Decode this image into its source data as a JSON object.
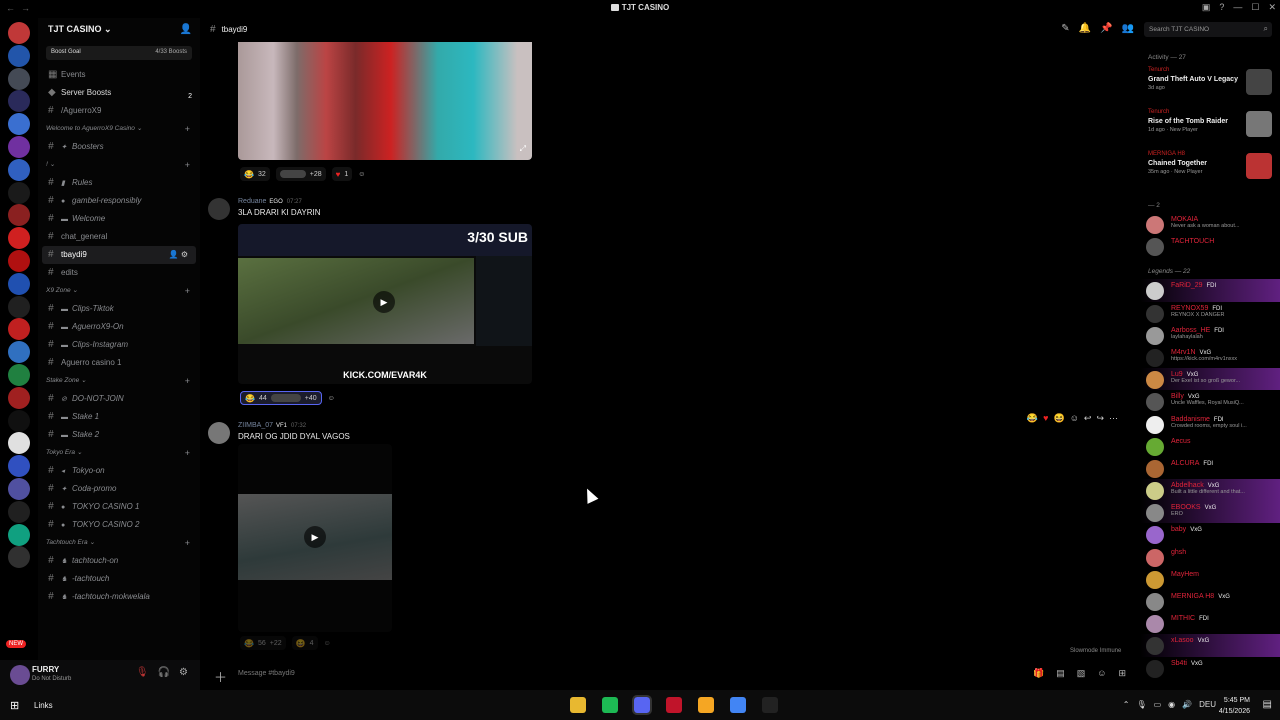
{
  "window": {
    "title": "TJT CASINO"
  },
  "server_rail": {
    "colors": [
      "#c03838",
      "#2255aa",
      "#444a55",
      "#2a2a5a",
      "#3a6fd0",
      "#7030a0",
      "#3060c0",
      "#1a1a1a",
      "#8a2020",
      "#d02020",
      "#b01010",
      "#2050b0",
      "#202020",
      "#c02020",
      "#3070c0",
      "#208040",
      "#a02020",
      "#101010",
      "#e0e0e0",
      "#3050c0",
      "#5050a0",
      "#202020",
      "#10a080",
      "#303030"
    ],
    "new_badge": "NEW"
  },
  "guild": {
    "name": "TJT CASINO",
    "boost_label": "Boost Goal",
    "boost_count": "4/33 Boosts"
  },
  "sidebar": {
    "events": "Events",
    "server_boosts": "Server Boosts",
    "server_boosts_badge": "2",
    "channels": [
      {
        "kind": "ch",
        "label": "/AguerroX9",
        "emoji": ""
      },
      {
        "kind": "cat",
        "label": "Welcome to AguerroX9 Casino"
      },
      {
        "kind": "ch",
        "label": "Boosters",
        "emoji": "✦",
        "italic": true
      },
      {
        "kind": "cat",
        "label": "!"
      },
      {
        "kind": "ch",
        "label": "Rules",
        "emoji": "▮",
        "italic": true
      },
      {
        "kind": "ch",
        "label": "gambel-responsibly",
        "emoji": "●",
        "italic": true
      },
      {
        "kind": "ch",
        "label": "Welcome",
        "emoji": "▬",
        "italic": true
      },
      {
        "kind": "ch",
        "label": "chat_general",
        "emoji": ""
      },
      {
        "kind": "ch",
        "label": "tbaydi9",
        "emoji": "",
        "active": true
      },
      {
        "kind": "ch",
        "label": "edits",
        "emoji": ""
      },
      {
        "kind": "cat",
        "label": "X9 Zone"
      },
      {
        "kind": "ch",
        "label": "Clips-Tiktok",
        "emoji": "▬",
        "italic": true
      },
      {
        "kind": "ch",
        "label": "AguerroX9-On",
        "emoji": "▬",
        "italic": true
      },
      {
        "kind": "ch",
        "label": "Clips-Instagram",
        "emoji": "▬",
        "italic": true
      },
      {
        "kind": "ch",
        "label": "Aguerro casino 1",
        "emoji": ""
      },
      {
        "kind": "cat",
        "label": "Stake Zone"
      },
      {
        "kind": "ch",
        "label": "DO-NOT-JOIN",
        "emoji": "⊘",
        "italic": true
      },
      {
        "kind": "ch",
        "label": "Stake 1",
        "emoji": "▬",
        "italic": true
      },
      {
        "kind": "ch",
        "label": "Stake 2",
        "emoji": "▬",
        "italic": true
      },
      {
        "kind": "cat",
        "label": "Tokyo Era"
      },
      {
        "kind": "ch",
        "label": "Tokyo-on",
        "emoji": "◂",
        "italic": true
      },
      {
        "kind": "ch",
        "label": "Coda-promo",
        "emoji": "✦",
        "italic": true
      },
      {
        "kind": "ch",
        "label": "TOKYO CASINO 1",
        "emoji": "●",
        "italic": true
      },
      {
        "kind": "ch",
        "label": "TOKYO CASINO 2",
        "emoji": "●",
        "italic": true
      },
      {
        "kind": "cat",
        "label": "Tachtouch Era"
      },
      {
        "kind": "ch",
        "label": "tachtouch-on",
        "emoji": "♞",
        "italic": true
      },
      {
        "kind": "ch",
        "label": "-tachtouch",
        "emoji": "♞",
        "italic": true
      },
      {
        "kind": "ch",
        "label": "-tachtouch-mokwelala",
        "emoji": "♞",
        "italic": true
      }
    ]
  },
  "user": {
    "name": "FURRY",
    "status": "Do Not Disturb"
  },
  "header": {
    "channel": "tbaydi9"
  },
  "search": {
    "placeholder": "Search TJT CASINO"
  },
  "messages": [
    {
      "reactions": [
        "32",
        "+28",
        "1"
      ]
    },
    {
      "author": "Reduane",
      "tag": "EGO",
      "time": "07:27",
      "text": "3LA DRARI KI DAYRIN",
      "overlay": "3/30 SUB",
      "kick": "KICK.COM/EVAR4K",
      "reactions": [
        "44",
        "+40"
      ]
    },
    {
      "author": "ZIIMBA_07",
      "tag": "VF1",
      "time": "07:32",
      "text": "DRARI OG JDID DYAL VAGOS",
      "reactions": [
        "56",
        "+22",
        "4"
      ]
    }
  ],
  "slowmode": "Slowmode Immune",
  "composer": {
    "placeholder": "Message #tbaydi9"
  },
  "members": {
    "activity_header": "Activity — 27",
    "activities": [
      {
        "user": "Tenurch",
        "game": "Grand Theft Auto V Legacy",
        "sub": "3d ago",
        "color": "#444"
      },
      {
        "user": "Tenurch",
        "game": "Rise of the Tomb Raider",
        "sub": "1d ago · New Player",
        "color": "#777"
      },
      {
        "user": "MERNIGA H8",
        "game": "Chained Together",
        "sub": "35m ago · New Player",
        "color": "#b33"
      }
    ],
    "group2_header": "— 2",
    "group2": [
      {
        "name": "MOKAIA",
        "status": "Never ask a woman about...",
        "color": "#c77"
      },
      {
        "name": "TACHTOUCH",
        "status": "",
        "color": "#555"
      }
    ],
    "legends_header": "Legends — 22",
    "legends": [
      {
        "name": "FaRiD_29",
        "tag": "FDI",
        "status": "",
        "color": "#ccc",
        "grad": true
      },
      {
        "name": "REYNOX59",
        "tag": "FDI",
        "status": "REYNOX X DANGER",
        "color": "#333"
      },
      {
        "name": "Aarboss_HE",
        "tag": "FDI",
        "status": "laylahaylalah",
        "color": "#999"
      },
      {
        "name": "M4rv1N",
        "tag": "VxG",
        "status": "https://kick.com/m4rv1nxxx",
        "color": "#222"
      },
      {
        "name": "Lu9",
        "tag": "VxG",
        "status": "Der Exel ist so groß gewor...",
        "color": "#c84",
        "grad": true
      },
      {
        "name": "Billy",
        "tag": "VxG",
        "status": "Uncle Waffles, Royal MusiQ...",
        "color": "#555"
      },
      {
        "name": "Baddanisme",
        "tag": "FDI",
        "status": "Crowded rooms, empty soul i...",
        "color": "#eee"
      },
      {
        "name": "Aecus",
        "tag": "",
        "status": "",
        "color": "#6a3"
      },
      {
        "name": "ALCURA",
        "tag": "FDI",
        "status": "",
        "color": "#a63"
      },
      {
        "name": "Abdelhack",
        "tag": "VxG",
        "status": "Built a little different and that...",
        "color": "#cc8",
        "grad": true
      },
      {
        "name": "EBOOKS",
        "tag": "VxG",
        "status": "ERO",
        "color": "#888",
        "grad": true
      },
      {
        "name": "baby",
        "tag": "VxG",
        "status": "",
        "color": "#96c"
      },
      {
        "name": "ghsh",
        "tag": "",
        "status": "",
        "color": "#c66"
      },
      {
        "name": "MayHem",
        "tag": "",
        "status": "",
        "color": "#c93"
      },
      {
        "name": "MERNIGA H8",
        "tag": "VxG",
        "status": "",
        "color": "#888"
      },
      {
        "name": "MITHIC",
        "tag": "FDI",
        "status": "",
        "color": "#a8a"
      },
      {
        "name": "xLasoo",
        "tag": "VxG",
        "status": "",
        "color": "#333",
        "grad": true
      },
      {
        "name": "Sb4ti",
        "tag": "VxG",
        "status": "",
        "color": "#222"
      }
    ]
  },
  "taskbar": {
    "search_label": "Links",
    "time": "5:45 PM",
    "date": "4/15/2026",
    "lang": "DEU",
    "apps": [
      "#e8b830",
      "#1db954",
      "#5865f2",
      "#c0142a",
      "#f5a623",
      "#4285f4",
      "#222222"
    ]
  }
}
